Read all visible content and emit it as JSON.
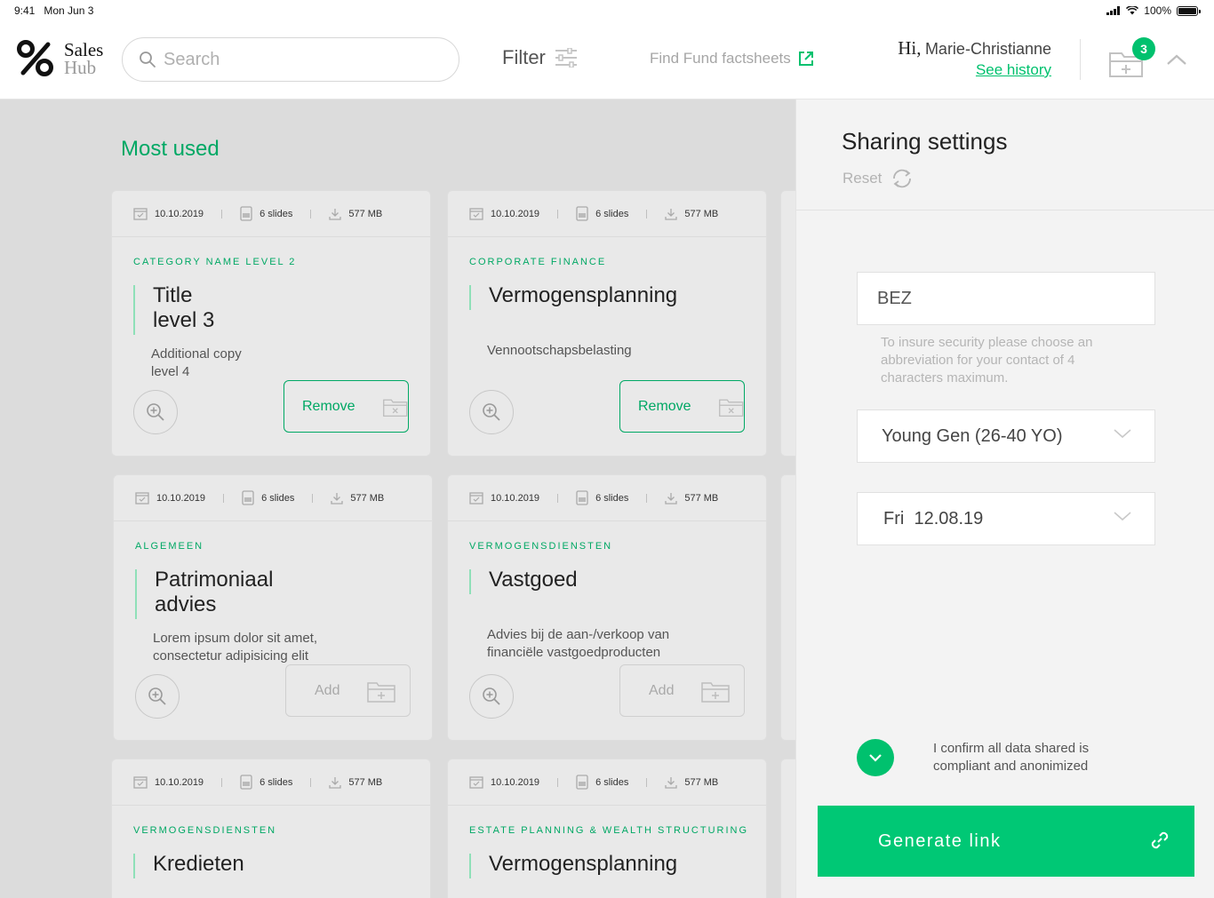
{
  "statusbar": {
    "time": "9:41",
    "date": "Mon Jun 3",
    "battery": "100%"
  },
  "header": {
    "logo_line1": "Sales",
    "logo_line2": "Hub",
    "search_placeholder": "Search",
    "filter_label": "Filter",
    "factsheets_label": "Find Fund factsheets",
    "greeting_hi": "Hi,",
    "user_name": "Marie-Christianne",
    "history_link": "See history",
    "cart_count": "3"
  },
  "main": {
    "section_title": "Most used",
    "cards": [
      {
        "date": "10.10.2019",
        "slides": "6 slides",
        "size": "577 MB",
        "category": "CATEGORY NAME LEVEL 2",
        "title": "Title level 3",
        "desc": "Additional copy level 4",
        "action": "Remove"
      },
      {
        "date": "10.10.2019",
        "slides": "6 slides",
        "size": "577 MB",
        "category": "CORPORATE FINANCE",
        "title": "Vermogensplanning",
        "desc": "Vennootschapsbelasting",
        "action": "Remove"
      },
      {
        "date": "10.10.2019",
        "slides": "6 slides",
        "size": "577 MB",
        "category": "ALGEMEEN",
        "title": "Patrimoniaal advies",
        "desc": "Lorem ipsum dolor sit amet, consectetur adipisicing elit",
        "action": "Add"
      },
      {
        "date": "10.10.2019",
        "slides": "6 slides",
        "size": "577 MB",
        "category": "VERMOGENSDIENSTEN",
        "title": "Vastgoed",
        "desc": "Advies bij de aan-/verkoop van financiële vastgoedproducten",
        "action": "Add"
      },
      {
        "date": "10.10.2019",
        "slides": "6 slides",
        "size": "577 MB",
        "category": "VERMOGENSDIENSTEN",
        "title": "Kredieten",
        "desc": "",
        "action": ""
      },
      {
        "date": "10.10.2019",
        "slides": "6 slides",
        "size": "577 MB",
        "category": "ESTATE PLANNING & WEALTH STRUCTURING",
        "title": "Vermogensplanning",
        "desc": "",
        "action": ""
      }
    ]
  },
  "panel": {
    "title": "Sharing settings",
    "reset_label": "Reset",
    "contact_value": "BEZ",
    "hint": "To insure security please choose an abbreviation for your contact of 4 characters maximum.",
    "segment_value": "Young Gen (26-40 YO)",
    "date_day": "Fri",
    "date_value": "12.08.19",
    "confirm_text": "I confirm all data shared is compliant and anonimized",
    "generate_label": "Generate link"
  },
  "colors": {
    "accent": "#00c16e",
    "accent_dark": "#00a864",
    "background": "#dcdcdc",
    "panel": "#f3f3f3"
  }
}
